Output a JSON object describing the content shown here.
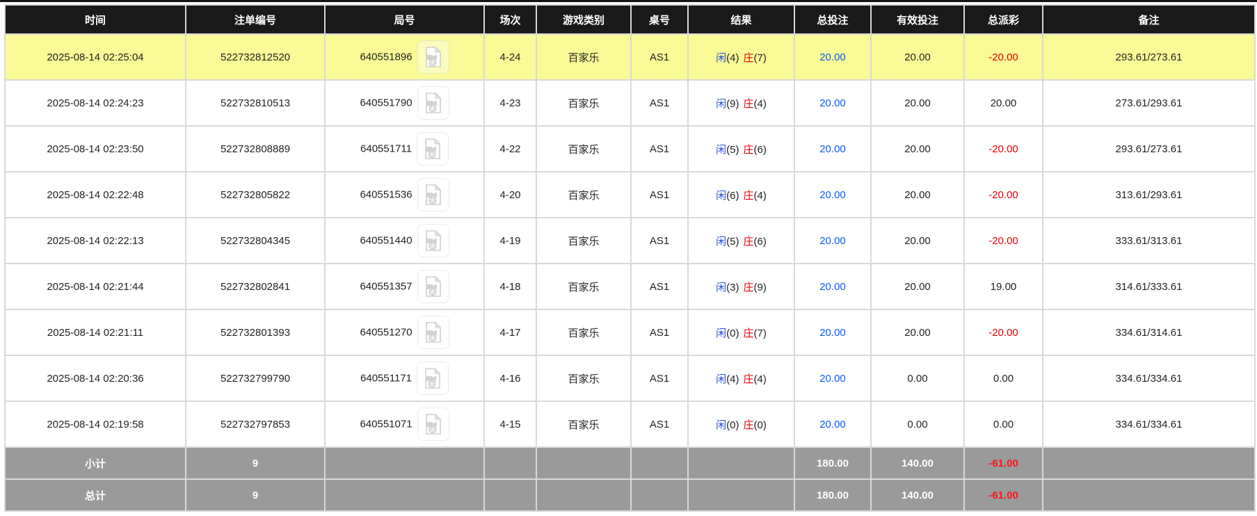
{
  "colors": {
    "header_bg": "#1a1a1a",
    "highlight_row": "#FAFA96",
    "amount_blue": "#0a5bf0",
    "player_blue": "#2a4fd8",
    "banker_red": "#e40000",
    "negative_red": "#e60000",
    "footer_bg": "#9a9a9a",
    "footer_negative_red": "#ff1515",
    "grid_line": "#d9d9d9"
  },
  "table": {
    "columns": [
      {
        "label": "时间"
      },
      {
        "label": "注单编号"
      },
      {
        "label": "局号"
      },
      {
        "label": "场次"
      },
      {
        "label": "游戏类别"
      },
      {
        "label": "桌号"
      },
      {
        "label": "结果"
      },
      {
        "label": "总投注"
      },
      {
        "label": "有效投注"
      },
      {
        "label": "总派彩"
      },
      {
        "label": "备注"
      }
    ],
    "video_icon": "video-file-icon",
    "rows": [
      {
        "time": "2025-08-14 02:25:04",
        "bet_id": "522732812520",
        "round_id": "640551896",
        "session": "4-24",
        "game_type": "百家乐",
        "table_no": "AS1",
        "result": {
          "player": "闲",
          "player_score": "(4)",
          "banker": "庄",
          "banker_score": "(7)"
        },
        "total_bet": "20.00",
        "valid_bet": "20.00",
        "payout": "-20.00",
        "remark": "293.61/273.61",
        "highlighted": true
      },
      {
        "time": "2025-08-14 02:24:23",
        "bet_id": "522732810513",
        "round_id": "640551790",
        "session": "4-23",
        "game_type": "百家乐",
        "table_no": "AS1",
        "result": {
          "player": "闲",
          "player_score": "(9)",
          "banker": "庄",
          "banker_score": "(4)"
        },
        "total_bet": "20.00",
        "valid_bet": "20.00",
        "payout": "20.00",
        "remark": "273.61/293.61",
        "highlighted": false
      },
      {
        "time": "2025-08-14 02:23:50",
        "bet_id": "522732808889",
        "round_id": "640551711",
        "session": "4-22",
        "game_type": "百家乐",
        "table_no": "AS1",
        "result": {
          "player": "闲",
          "player_score": "(5)",
          "banker": "庄",
          "banker_score": "(6)"
        },
        "total_bet": "20.00",
        "valid_bet": "20.00",
        "payout": "-20.00",
        "remark": "293.61/273.61",
        "highlighted": false
      },
      {
        "time": "2025-08-14 02:22:48",
        "bet_id": "522732805822",
        "round_id": "640551536",
        "session": "4-20",
        "game_type": "百家乐",
        "table_no": "AS1",
        "result": {
          "player": "闲",
          "player_score": "(6)",
          "banker": "庄",
          "banker_score": "(4)"
        },
        "total_bet": "20.00",
        "valid_bet": "20.00",
        "payout": "-20.00",
        "remark": "313.61/293.61",
        "highlighted": false
      },
      {
        "time": "2025-08-14 02:22:13",
        "bet_id": "522732804345",
        "round_id": "640551440",
        "session": "4-19",
        "game_type": "百家乐",
        "table_no": "AS1",
        "result": {
          "player": "闲",
          "player_score": "(5)",
          "banker": "庄",
          "banker_score": "(6)"
        },
        "total_bet": "20.00",
        "valid_bet": "20.00",
        "payout": "-20.00",
        "remark": "333.61/313.61",
        "highlighted": false
      },
      {
        "time": "2025-08-14 02:21:44",
        "bet_id": "522732802841",
        "round_id": "640551357",
        "session": "4-18",
        "game_type": "百家乐",
        "table_no": "AS1",
        "result": {
          "player": "闲",
          "player_score": "(3)",
          "banker": "庄",
          "banker_score": "(9)"
        },
        "total_bet": "20.00",
        "valid_bet": "20.00",
        "payout": "19.00",
        "remark": "314.61/333.61",
        "highlighted": false
      },
      {
        "time": "2025-08-14 02:21:11",
        "bet_id": "522732801393",
        "round_id": "640551270",
        "session": "4-17",
        "game_type": "百家乐",
        "table_no": "AS1",
        "result": {
          "player": "闲",
          "player_score": "(0)",
          "banker": "庄",
          "banker_score": "(7)"
        },
        "total_bet": "20.00",
        "valid_bet": "20.00",
        "payout": "-20.00",
        "remark": "334.61/314.61",
        "highlighted": false
      },
      {
        "time": "2025-08-14 02:20:36",
        "bet_id": "522732799790",
        "round_id": "640551171",
        "session": "4-16",
        "game_type": "百家乐",
        "table_no": "AS1",
        "result": {
          "player": "闲",
          "player_score": "(4)",
          "banker": "庄",
          "banker_score": "(4)"
        },
        "total_bet": "20.00",
        "valid_bet": "0.00",
        "payout": "0.00",
        "remark": "334.61/334.61",
        "highlighted": false
      },
      {
        "time": "2025-08-14 02:19:58",
        "bet_id": "522732797853",
        "round_id": "640551071",
        "session": "4-15",
        "game_type": "百家乐",
        "table_no": "AS1",
        "result": {
          "player": "闲",
          "player_score": "(0)",
          "banker": "庄",
          "banker_score": "(0)"
        },
        "total_bet": "20.00",
        "valid_bet": "0.00",
        "payout": "0.00",
        "remark": "334.61/334.61",
        "highlighted": false
      }
    ],
    "summary_rows": [
      {
        "label": "小计",
        "count": "9",
        "total_bet": "180.00",
        "valid_bet": "140.00",
        "payout": "-61.00"
      },
      {
        "label": "总计",
        "count": "9",
        "total_bet": "180.00",
        "valid_bet": "140.00",
        "payout": "-61.00"
      }
    ]
  }
}
